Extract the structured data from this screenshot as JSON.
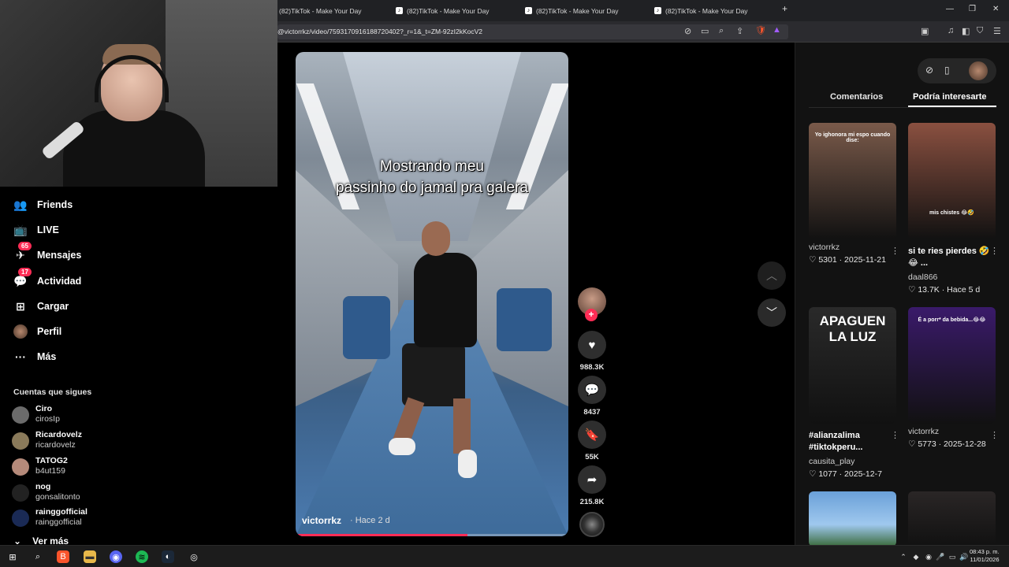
{
  "browser": {
    "tabs": [
      {
        "title": "(82)TikTok - Make Your Day"
      },
      {
        "title": "(82)TikTok - Make Your Day"
      },
      {
        "title": "(82)TikTok - Make Your Day"
      },
      {
        "title": "(82)TikTok - Make Your Day"
      }
    ],
    "new_tab": "+",
    "url": "@victorrkz/video/7593170916188720402?_r=1&_t=ZM-92zI2kKocV2",
    "window": {
      "minimize": "—",
      "restore": "❐",
      "close": "✕"
    }
  },
  "sidebar": {
    "items": [
      {
        "label": "Friends",
        "icon": "friends-icon",
        "glyph": "👥"
      },
      {
        "label": "LIVE",
        "icon": "live-icon",
        "glyph": "📺"
      },
      {
        "label": "Mensajes",
        "icon": "messages-icon",
        "glyph": "✈",
        "badge": "65"
      },
      {
        "label": "Actividad",
        "icon": "activity-icon",
        "glyph": "💬",
        "badge": "17"
      },
      {
        "label": "Cargar",
        "icon": "upload-icon",
        "glyph": "⊞"
      },
      {
        "label": "Perfil",
        "icon": "profile-avatar",
        "glyph": ""
      },
      {
        "label": "Más",
        "icon": "more-icon",
        "glyph": "···"
      }
    ],
    "following_title": "Cuentas que sigues",
    "following": [
      {
        "name": "Ciro",
        "handle": "cirosIp",
        "color": "#6b6b6b"
      },
      {
        "name": "Ricardovelz",
        "handle": "ricardovelz",
        "color": "#8a7a5a"
      },
      {
        "name": "TATOG2",
        "handle": "b4ut159",
        "color": "#b58a7a"
      },
      {
        "name": "nog",
        "handle": "gonsalitonto",
        "color": "#222222"
      },
      {
        "name": "rainggofficial",
        "handle": "rainggofficial",
        "color": "#1a2a55"
      }
    ],
    "see_more": "Ver más"
  },
  "video": {
    "caption_line1": "Mostrando meu",
    "caption_line2": "passinho do jamal pra galera",
    "author": "victorrkz",
    "time": "· Hace 2 d",
    "progress": 0.63
  },
  "actions": {
    "likes": "988.3K",
    "comments": "8437",
    "saves": "55K",
    "shares": "215.8K"
  },
  "right_panel": {
    "tabs": [
      "Comentarios",
      "Podría interesarte"
    ],
    "cards": [
      {
        "title": "",
        "user": "victorrkz",
        "likes": "5301",
        "date": "2025-11-21",
        "thumb_text": "Yo ighonora mi espo cuando dise:",
        "bg": "#7a5a4a"
      },
      {
        "title": "si te ries pierdes 🤣 😂 ...",
        "user": "daal866",
        "likes": "13.7K",
        "date": "Hace 5 d",
        "thumb_text": "mis chistes 😂🤣",
        "bg": "#8a5040"
      },
      {
        "title": "#alianzalima #tiktokperu...",
        "user": "causita_play",
        "likes": "1077",
        "date": "2025-12-7",
        "thumb_text": "APAGUEN LA LUZ",
        "bg": "#2a2a2a"
      },
      {
        "title": "",
        "user": "victorrkz",
        "likes": "5773",
        "date": "2025-12-28",
        "thumb_text": "É a porr* da bebida...😂😂",
        "bg": "#3a1a6a"
      },
      {
        "title": "",
        "user": "",
        "likes": "",
        "date": "",
        "thumb_text": "",
        "bg": "#6aa0d8"
      },
      {
        "title": "",
        "user": "",
        "likes": "",
        "date": "",
        "thumb_text": "",
        "bg": "#2a2626"
      }
    ]
  },
  "taskbar": {
    "time": "08:43 p. m.",
    "date": "11/01/2026"
  }
}
